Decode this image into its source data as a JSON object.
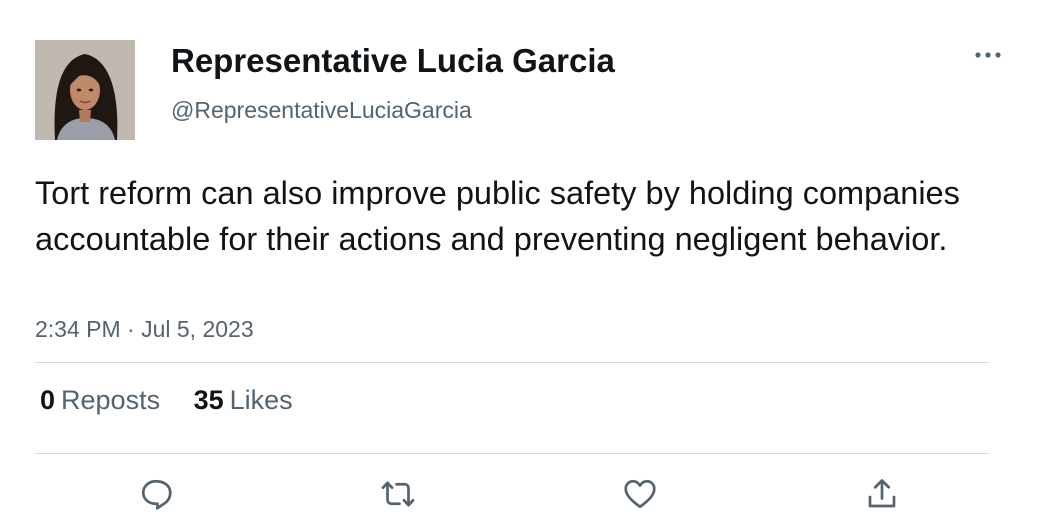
{
  "author": {
    "display_name": "Representative Lucia Garcia",
    "handle": "@RepresentativeLuciaGarcia",
    "avatar_icon": "profile-photo"
  },
  "tweet": {
    "text": "Tort reform can also improve public safety by holding companies accountable for their actions and preventing negligent behavior.",
    "timestamp": "2:34 PM · Jul 5, 2023"
  },
  "stats": {
    "reposts_count": "0",
    "reposts_label": "Reposts",
    "likes_count": "35",
    "likes_label": "Likes"
  },
  "actions": {
    "icons": [
      "reply-icon",
      "repost-icon",
      "like-icon",
      "share-icon"
    ]
  },
  "colors": {
    "text_primary": "#0f1419",
    "text_secondary": "#536471",
    "divider": "#cfd9de",
    "icon": "#536471"
  }
}
